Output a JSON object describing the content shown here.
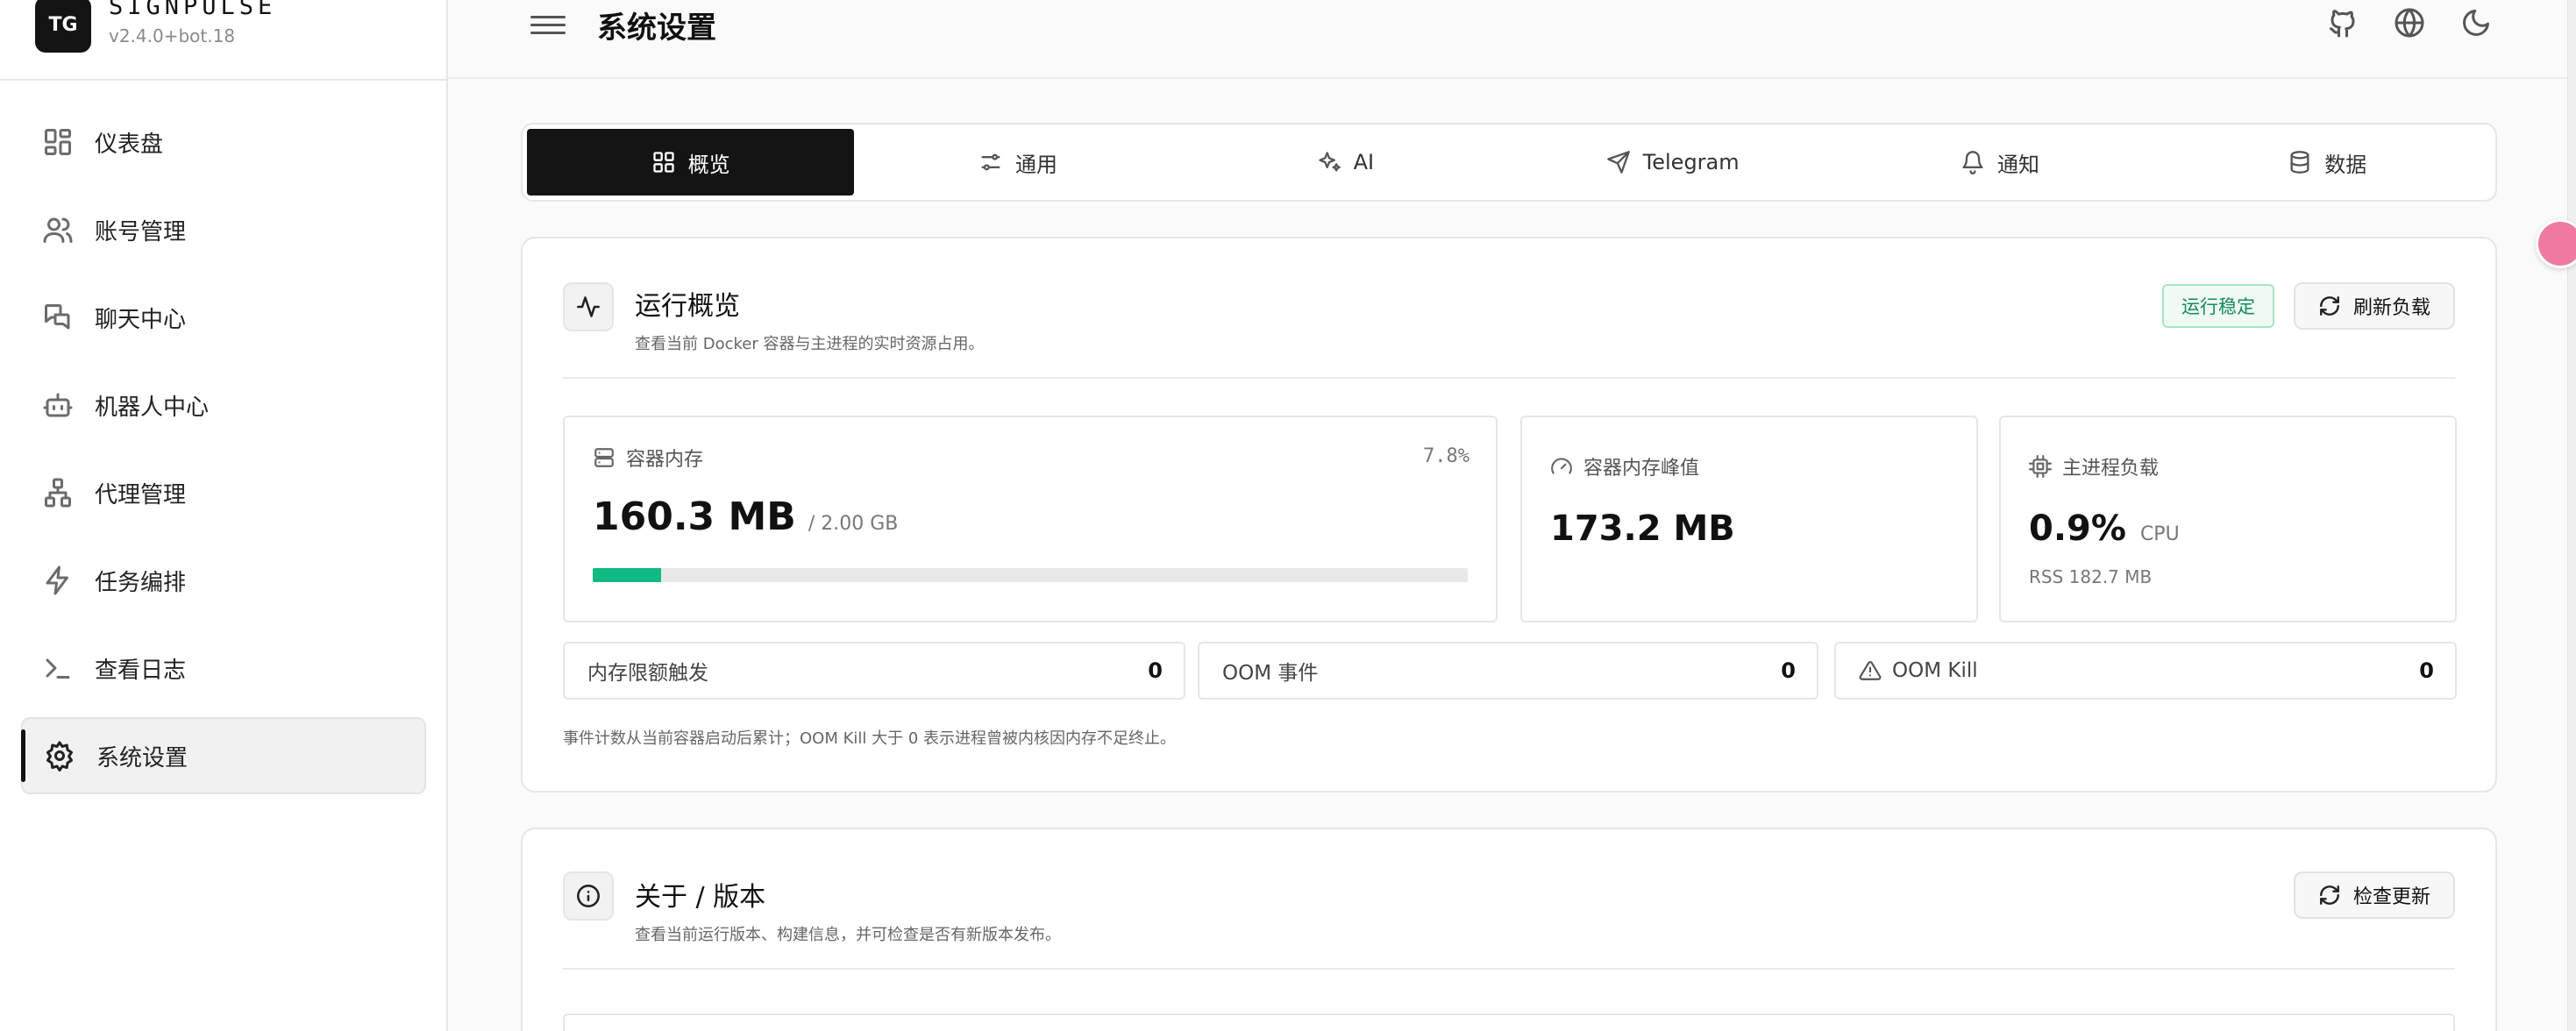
{
  "brand": {
    "logo": "TG",
    "name": "SIGNPULSE",
    "version": "v2.4.0+bot.18"
  },
  "sidebar": {
    "items": [
      {
        "label": "仪表盘",
        "icon": "dashboard-icon"
      },
      {
        "label": "账号管理",
        "icon": "users-icon"
      },
      {
        "label": "聊天中心",
        "icon": "chat-icon"
      },
      {
        "label": "机器人中心",
        "icon": "bot-icon"
      },
      {
        "label": "代理管理",
        "icon": "network-icon"
      },
      {
        "label": "任务编排",
        "icon": "lightning-icon"
      },
      {
        "label": "查看日志",
        "icon": "terminal-icon"
      },
      {
        "label": "系统设置",
        "icon": "gear-icon",
        "active": true
      }
    ]
  },
  "header": {
    "title": "系统设置",
    "icons": [
      "github-icon",
      "globe-icon",
      "moon-icon"
    ]
  },
  "tabs": [
    {
      "label": "概览",
      "icon": "grid-icon",
      "active": true
    },
    {
      "label": "通用",
      "icon": "sliders-icon"
    },
    {
      "label": "AI",
      "icon": "sparkles-icon"
    },
    {
      "label": "Telegram",
      "icon": "send-icon"
    },
    {
      "label": "通知",
      "icon": "bell-icon"
    },
    {
      "label": "数据",
      "icon": "database-icon"
    }
  ],
  "overview": {
    "title": "运行概览",
    "desc": "查看当前 Docker 容器与主进程的实时资源占用。",
    "badge": "运行稳定",
    "refresh_label": "刷新负载",
    "memory": {
      "label": "容器内存",
      "value": "160.3 MB",
      "limit": "/ 2.00 GB",
      "percent_text": "7.8%",
      "percent": 7.8
    },
    "peak": {
      "label": "容器内存峰值",
      "value": "173.2 MB"
    },
    "cpu": {
      "label": "主进程负载",
      "value": "0.9%",
      "unit": "CPU",
      "rss": "RSS 182.7 MB"
    },
    "counters": [
      {
        "label": "内存限额触发",
        "value": "0"
      },
      {
        "label": "OOM 事件",
        "value": "0"
      },
      {
        "label": "OOM Kill",
        "value": "0",
        "icon": "warning-icon"
      }
    ],
    "note": "事件计数从当前容器启动后累计；OOM Kill 大于 0 表示进程曾被内核因内存不足终止。"
  },
  "about": {
    "title": "关于 / 版本",
    "desc": "查看当前运行版本、构建信息，并可检查是否有新版本发布。",
    "check_label": "检查更新"
  },
  "colors": {
    "accent": "#141414",
    "success": "#10b981",
    "badge_text": "#18895a"
  }
}
